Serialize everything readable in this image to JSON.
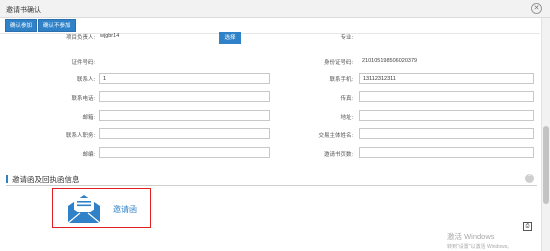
{
  "window": {
    "title": "邀请书确认"
  },
  "toolbar": {
    "confirm_join": "确认参加",
    "confirm_not_join": "确认不参加"
  },
  "form": {
    "project_leader_label": "项目负责人:",
    "project_leader_value": "wjgbr14",
    "select_button": "选择",
    "major_label": "专业:",
    "cert_no_label": "证件号码:",
    "id_no_label": "身份证号码:",
    "id_no_value": "210105198506020379",
    "contact_label": "联系人:",
    "contact_value": "1",
    "contact_mobile_label": "联系手机:",
    "contact_mobile_value": "13112312311",
    "contact_phone_label": "联系电话:",
    "fax_label": "传真:",
    "email_label": "邮箱:",
    "address_label": "地址:",
    "contact_dept_label": "联系人职务:",
    "trade_subject_label": "交易主体姓名:",
    "postcode_label": "邮编:",
    "invite_pages_label": "邀请书页数:"
  },
  "section": {
    "title": "邀请函及回执函信息"
  },
  "invite_card": {
    "label": "邀请函",
    "icon": "envelope-icon"
  },
  "watermark": {
    "line1": "激活 Windows",
    "line2": "转到\"设置\"以激活 Windows。"
  },
  "colors": {
    "accent": "#2f82c8",
    "highlight": "#e02020"
  }
}
